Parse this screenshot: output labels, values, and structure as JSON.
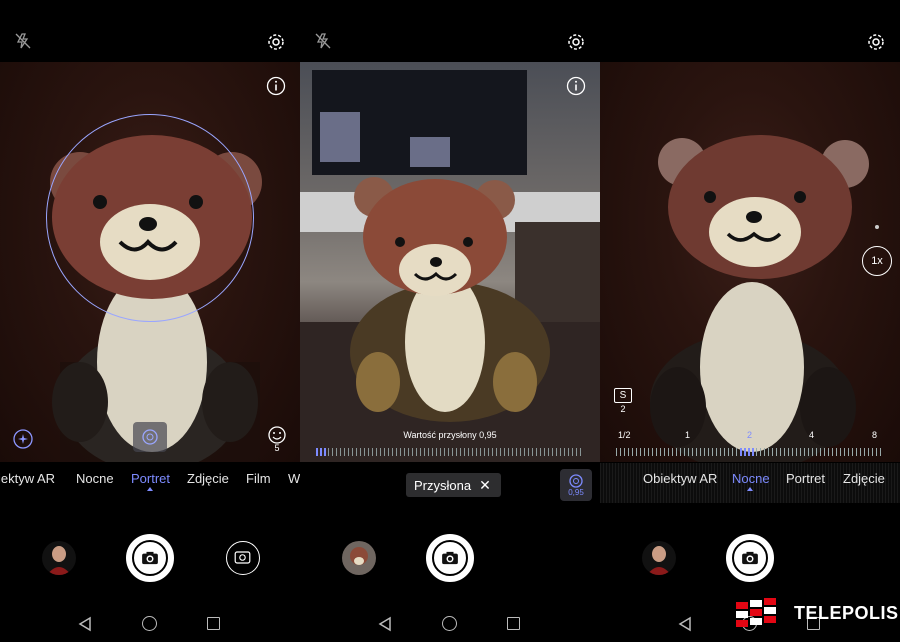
{
  "panels": [
    {
      "modes": [
        "iektyw AR",
        "Nocne",
        "Portret",
        "Zdjęcie",
        "Film",
        "W"
      ],
      "active_mode": "Portret",
      "face_count": "5",
      "icons": {
        "flash": "flash-off-icon",
        "settings": "gear-icon",
        "info": "info-icon"
      }
    },
    {
      "aperture_label": "Wartość przysłony 0,95",
      "chip_label": "Przysłona",
      "aperture_value": "0,95"
    },
    {
      "modes": [
        "Obiektyw AR",
        "Nocne",
        "Portret",
        "Zdjęcie"
      ],
      "active_mode": "Nocne",
      "shutter_letter": "S",
      "shutter_value": "2",
      "shutter_scale": [
        "1/2",
        "1",
        "2",
        "4",
        "8"
      ],
      "zoom": "1x"
    }
  ],
  "watermark": {
    "text": "TELEPOLIS"
  },
  "colors": {
    "accent": "#7d8bff"
  }
}
